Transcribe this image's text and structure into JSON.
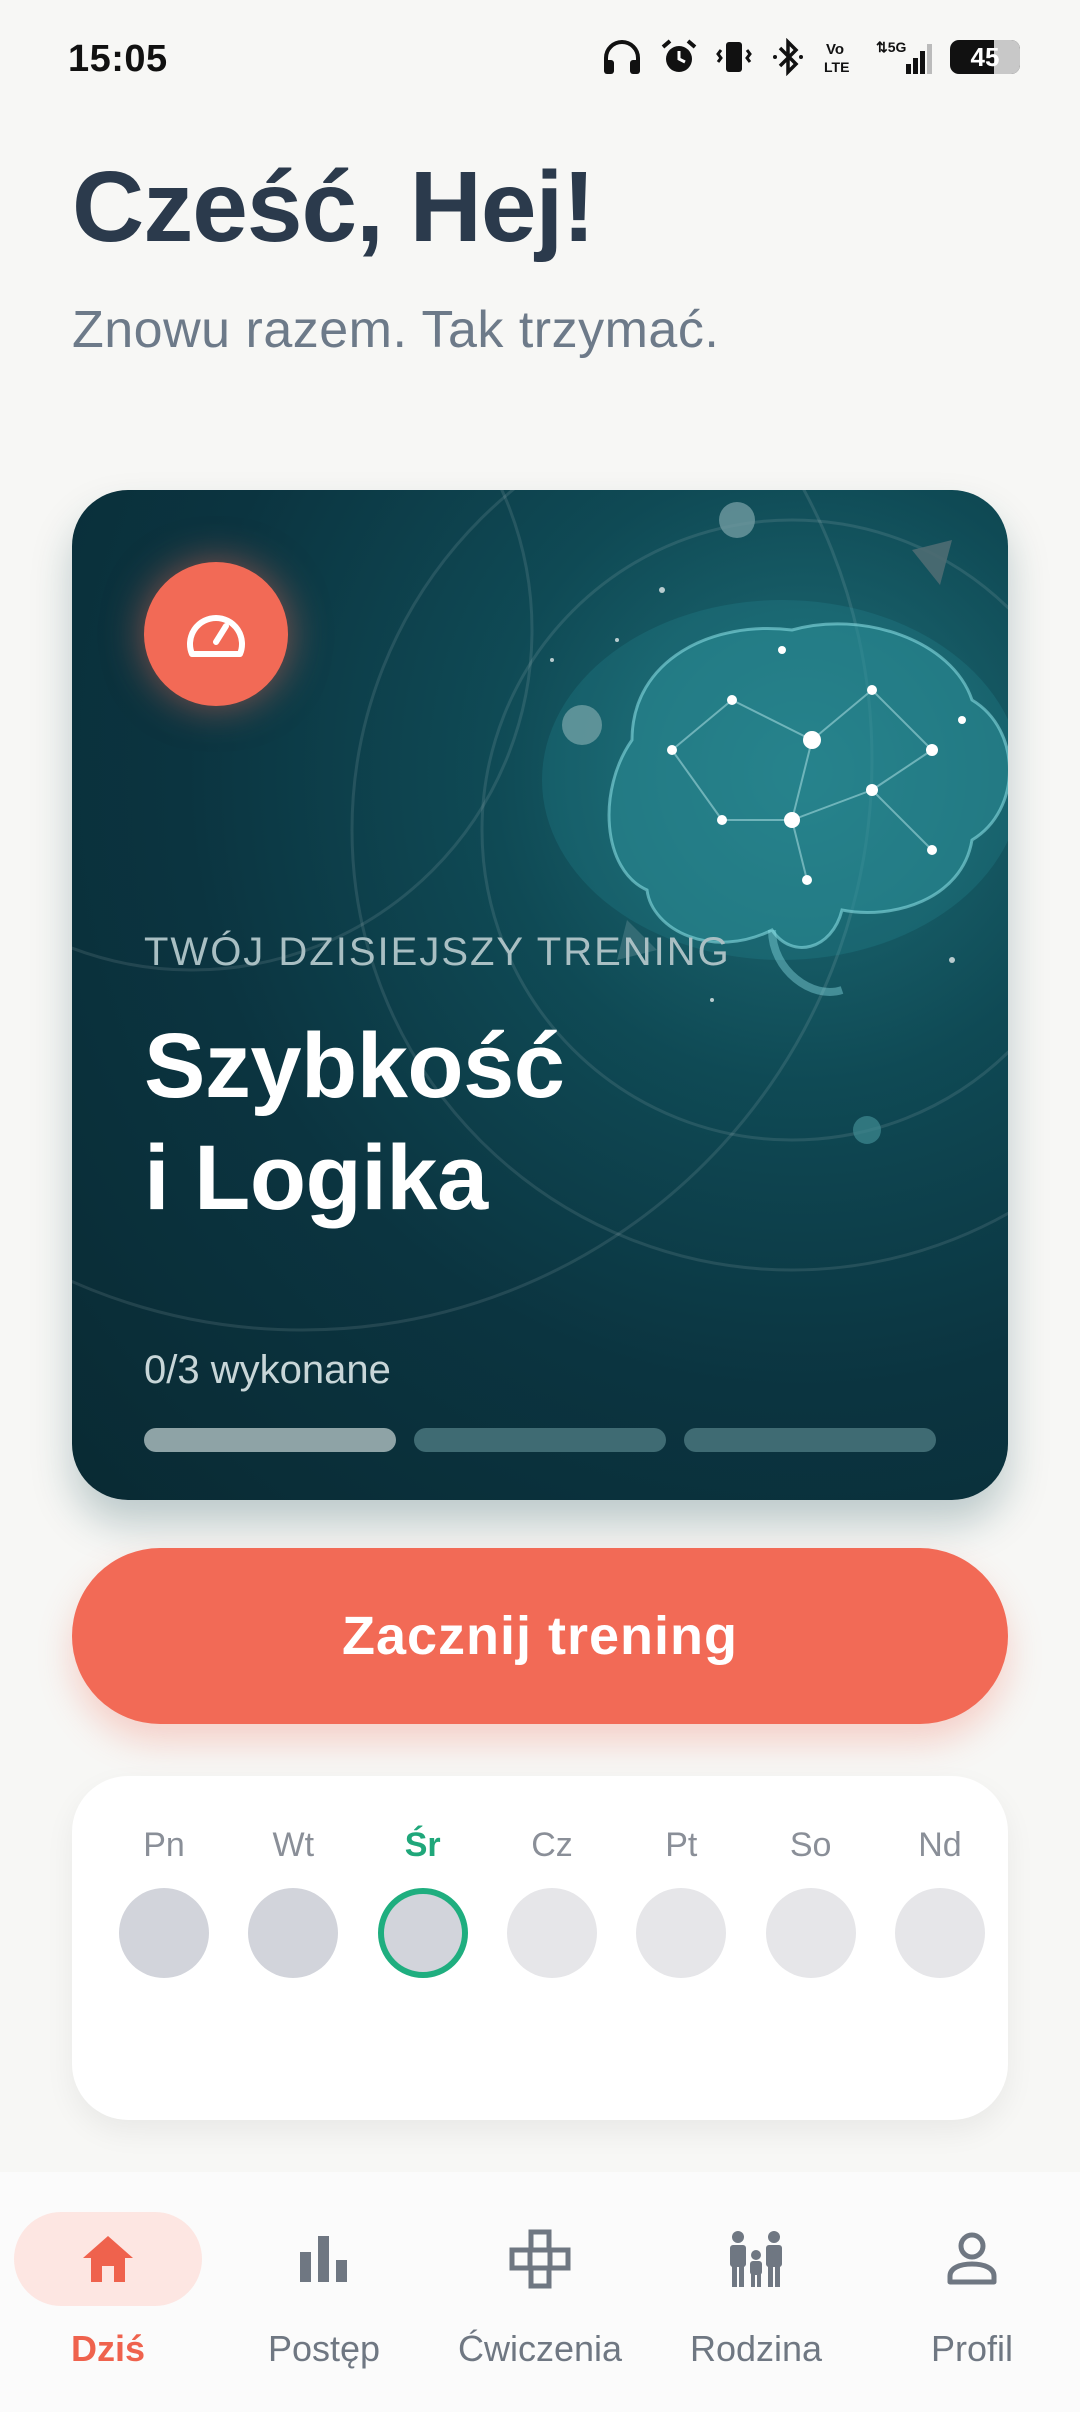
{
  "status_bar": {
    "time": "15:05",
    "battery": "45",
    "network": "5G",
    "volte": "Vo\nLTE"
  },
  "header": {
    "greeting": "Cześć, Hej!",
    "subtitle": "Znowu razem. Tak trzymać."
  },
  "hero": {
    "icon": "speedometer-icon",
    "label": "TWÓJ DZISIEJSZY TRENING",
    "title_line1": "Szybkość",
    "title_line2": "i Logika",
    "progress_text": "0/3 wykonane",
    "progress": {
      "done": 0,
      "total": 3
    }
  },
  "cta": {
    "label": "Zacznij trening"
  },
  "week": {
    "days": [
      {
        "label": "Pn",
        "state": "past"
      },
      {
        "label": "Wt",
        "state": "past"
      },
      {
        "label": "Śr",
        "state": "today"
      },
      {
        "label": "Cz",
        "state": "future"
      },
      {
        "label": "Pt",
        "state": "future"
      },
      {
        "label": "So",
        "state": "future"
      },
      {
        "label": "Nd",
        "state": "future"
      }
    ]
  },
  "nav": {
    "items": [
      {
        "label": "Dziś",
        "icon": "home-icon",
        "active": true
      },
      {
        "label": "Postęp",
        "icon": "bar-chart-icon",
        "active": false
      },
      {
        "label": "Ćwiczenia",
        "icon": "gamepad-icon",
        "active": false
      },
      {
        "label": "Rodzina",
        "icon": "family-icon",
        "active": false
      },
      {
        "label": "Profil",
        "icon": "user-icon",
        "active": false
      }
    ]
  },
  "colors": {
    "accent": "#f26a56",
    "today": "#1fae7f",
    "title": "#2b3a4c",
    "card_dark": "#0b3440"
  }
}
